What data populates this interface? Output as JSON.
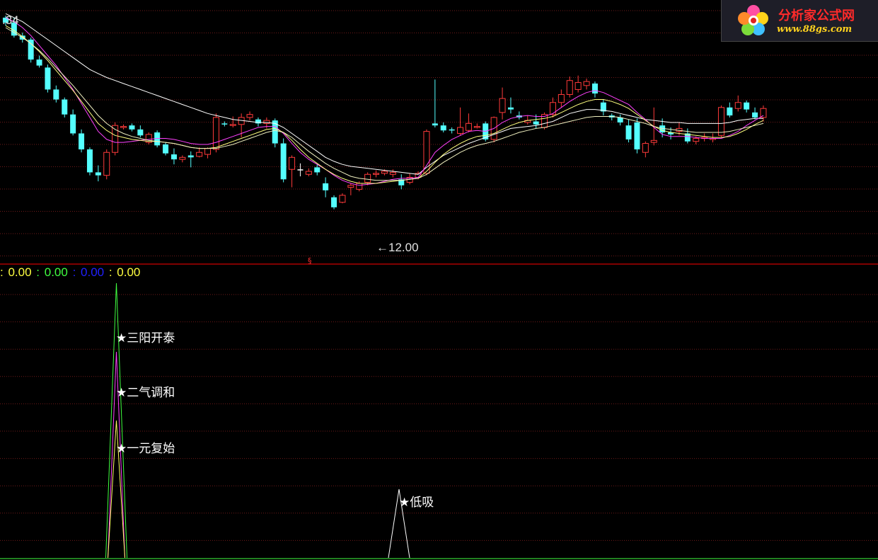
{
  "price_panel": {
    "high_label": ".34",
    "low_label": "←12.00",
    "marker": "§",
    "colors": {
      "up": "#ff3a3a",
      "down": "#54ffff",
      "doji": "#ffffff",
      "grid": "#6e1a1a",
      "divider": "#ff0000",
      "ma_white": "#ffffff",
      "ma_magenta": "#ff40ff",
      "ma_yellow": "#ffff80",
      "ma_ivory": "#f0f0c0"
    }
  },
  "indicator_panel": {
    "readout": [
      {
        "sep": ": ",
        "value": "0.00",
        "color": "#ffff40"
      },
      {
        "sep": ": ",
        "value": "0.00",
        "color": "#40ff40"
      },
      {
        "sep": ": ",
        "value": "0.00",
        "color": "#2020ff"
      },
      {
        "sep": ": ",
        "value": "0.00",
        "color": "#ffff40"
      }
    ],
    "signals": [
      {
        "label": "★三阳开泰",
        "series": "green"
      },
      {
        "label": "★二气调和",
        "series": "magenta"
      },
      {
        "label": "★一元复始",
        "series": "yellow"
      },
      {
        "label": "★低吸",
        "series": "white"
      }
    ]
  },
  "logo": {
    "brand": "分析家公式网",
    "url": "www.88gs.com",
    "icon": "flower-logo-icon"
  },
  "chart_data": {
    "type": "candlestick",
    "title": "",
    "y_range_approx": [
      12.0,
      14.34
    ],
    "candles": [
      [
        14.3,
        14.32,
        14.22,
        14.25
      ],
      [
        14.25,
        14.3,
        14.1,
        14.12
      ],
      [
        14.12,
        14.15,
        14.05,
        14.08
      ],
      [
        14.08,
        14.1,
        13.85,
        13.88
      ],
      [
        13.88,
        13.92,
        13.8,
        13.82
      ],
      [
        13.8,
        13.83,
        13.55,
        13.58
      ],
      [
        13.58,
        13.62,
        13.45,
        13.48
      ],
      [
        13.48,
        13.5,
        13.3,
        13.33
      ],
      [
        13.33,
        13.38,
        13.12,
        13.14
      ],
      [
        13.14,
        13.18,
        12.95,
        12.98
      ],
      [
        12.98,
        13.0,
        12.72,
        12.75
      ],
      [
        12.75,
        12.82,
        12.66,
        12.72
      ],
      [
        12.72,
        12.98,
        12.68,
        12.95
      ],
      [
        12.95,
        13.25,
        12.92,
        13.22
      ],
      [
        13.2,
        13.23,
        13.18,
        13.21
      ],
      [
        13.22,
        13.24,
        13.16,
        13.18
      ],
      [
        13.18,
        13.22,
        13.1,
        13.12
      ],
      [
        13.05,
        13.15,
        13.03,
        13.13
      ],
      [
        13.15,
        13.17,
        13.0,
        13.02
      ],
      [
        13.03,
        13.05,
        12.92,
        12.94
      ],
      [
        12.93,
        12.99,
        12.83,
        12.88
      ],
      [
        12.88,
        12.92,
        12.85,
        12.9
      ],
      [
        12.92,
        12.96,
        12.8,
        12.9
      ],
      [
        12.91,
        13.0,
        12.9,
        12.95
      ],
      [
        12.93,
        13.0,
        12.89,
        12.99
      ],
      [
        12.98,
        13.34,
        12.95,
        13.3
      ],
      [
        13.24,
        13.26,
        13.21,
        13.23
      ],
      [
        13.22,
        13.31,
        13.2,
        13.23
      ],
      [
        13.23,
        13.34,
        13.1,
        13.3
      ],
      [
        13.3,
        13.36,
        13.27,
        13.33
      ],
      [
        13.28,
        13.3,
        13.21,
        13.24
      ],
      [
        13.24,
        13.3,
        13.19,
        13.27
      ],
      [
        13.27,
        13.29,
        13.0,
        13.04
      ],
      [
        13.04,
        13.09,
        12.65,
        12.68
      ],
      [
        12.78,
        12.92,
        12.6,
        12.9
      ],
      [
        12.78,
        12.84,
        12.71,
        12.78
      ],
      [
        12.73,
        12.79,
        12.71,
        12.76
      ],
      [
        12.8,
        12.83,
        12.72,
        12.75
      ],
      [
        12.64,
        12.7,
        12.5,
        12.57
      ],
      [
        12.5,
        12.52,
        12.38,
        12.4
      ],
      [
        12.45,
        12.54,
        12.44,
        12.52
      ],
      [
        12.6,
        12.64,
        12.52,
        12.62
      ],
      [
        12.58,
        12.66,
        12.56,
        12.64
      ],
      [
        12.65,
        12.75,
        12.62,
        12.73
      ],
      [
        12.73,
        12.77,
        12.7,
        12.74
      ],
      [
        12.74,
        12.78,
        12.72,
        12.76
      ],
      [
        12.73,
        12.78,
        12.7,
        12.75
      ],
      [
        12.68,
        12.73,
        12.58,
        12.62
      ],
      [
        12.65,
        12.74,
        12.63,
        12.7
      ],
      [
        12.7,
        12.76,
        12.68,
        12.74
      ],
      [
        12.74,
        13.18,
        12.72,
        13.16
      ],
      [
        13.24,
        13.68,
        13.2,
        13.22
      ],
      [
        13.22,
        13.25,
        13.15,
        13.17
      ],
      [
        13.18,
        13.2,
        13.14,
        13.17
      ],
      [
        13.14,
        13.4,
        13.12,
        13.2
      ],
      [
        13.17,
        13.34,
        13.15,
        13.24
      ],
      [
        13.2,
        13.24,
        13.19,
        13.21
      ],
      [
        13.24,
        13.26,
        13.06,
        13.08
      ],
      [
        13.08,
        13.31,
        13.05,
        13.3
      ],
      [
        13.35,
        13.6,
        13.28,
        13.49
      ],
      [
        13.4,
        13.5,
        13.34,
        13.38
      ],
      [
        13.32,
        13.36,
        13.28,
        13.3
      ],
      [
        13.25,
        13.32,
        13.23,
        13.27
      ],
      [
        13.26,
        13.33,
        13.19,
        13.23
      ],
      [
        13.2,
        13.35,
        13.18,
        13.33
      ],
      [
        13.33,
        13.5,
        13.3,
        13.45
      ],
      [
        13.45,
        13.58,
        13.4,
        13.53
      ],
      [
        13.53,
        13.71,
        13.5,
        13.67
      ],
      [
        13.58,
        13.72,
        13.55,
        13.65
      ],
      [
        13.62,
        13.69,
        13.58,
        13.66
      ],
      [
        13.64,
        13.66,
        13.5,
        13.54
      ],
      [
        13.45,
        13.48,
        13.32,
        13.36
      ],
      [
        13.32,
        13.34,
        13.27,
        13.3
      ],
      [
        13.3,
        13.33,
        13.22,
        13.25
      ],
      [
        13.22,
        13.28,
        13.05,
        13.08
      ],
      [
        13.25,
        13.29,
        12.94,
        12.98
      ],
      [
        12.95,
        13.06,
        12.9,
        13.04
      ],
      [
        13.05,
        13.4,
        13.02,
        13.07
      ],
      [
        13.22,
        13.29,
        13.1,
        13.15
      ],
      [
        13.15,
        13.2,
        13.08,
        13.13
      ],
      [
        13.16,
        13.25,
        13.12,
        13.19
      ],
      [
        13.14,
        13.19,
        13.04,
        13.06
      ],
      [
        13.06,
        13.11,
        13.03,
        13.09
      ],
      [
        13.09,
        13.14,
        13.06,
        13.1
      ],
      [
        13.08,
        13.14,
        13.05,
        13.09
      ],
      [
        13.12,
        13.42,
        13.1,
        13.4
      ],
      [
        13.4,
        13.45,
        13.3,
        13.32
      ],
      [
        13.39,
        13.52,
        13.36,
        13.45
      ],
      [
        13.45,
        13.47,
        13.35,
        13.38
      ],
      [
        13.35,
        13.4,
        13.28,
        13.3
      ],
      [
        13.3,
        13.42,
        13.26,
        13.39
      ]
    ],
    "moving_averages": {
      "white": [
        14.34,
        14.3,
        14.26,
        14.2,
        14.14,
        14.08,
        14.02,
        13.96,
        13.9,
        13.84,
        13.78,
        13.74,
        13.7,
        13.67,
        13.64,
        13.61,
        13.58,
        13.55,
        13.52,
        13.49,
        13.46,
        13.43,
        13.4,
        13.37,
        13.34,
        13.32,
        13.3,
        13.28,
        13.27,
        13.26,
        13.25,
        13.25,
        13.24,
        13.2,
        13.14,
        13.08,
        13.02,
        12.96,
        12.9,
        12.86,
        12.83,
        12.81,
        12.8,
        12.79,
        12.78,
        12.77,
        12.76,
        12.75,
        12.74,
        12.73,
        12.8,
        12.86,
        12.92,
        12.96,
        13.0,
        13.04,
        13.07,
        13.1,
        13.13,
        13.16,
        13.19,
        13.2,
        13.21,
        13.22,
        13.24,
        13.26,
        13.3,
        13.34,
        13.36,
        13.38,
        13.38,
        13.37,
        13.36,
        13.34,
        13.32,
        13.3,
        13.28,
        13.27,
        13.26,
        13.25,
        13.25,
        13.24,
        13.24,
        13.24,
        13.24,
        13.24,
        13.25,
        13.27,
        13.28,
        13.29,
        13.29
      ],
      "magenta": [
        14.3,
        14.26,
        14.2,
        14.12,
        14.02,
        13.92,
        13.82,
        13.7,
        13.58,
        13.44,
        13.3,
        13.16,
        13.08,
        13.05,
        13.05,
        13.06,
        13.07,
        13.08,
        13.09,
        13.09,
        13.08,
        13.06,
        13.04,
        13.03,
        13.03,
        13.05,
        13.08,
        13.11,
        13.14,
        13.17,
        13.2,
        13.21,
        13.21,
        13.14,
        13.04,
        12.95,
        12.88,
        12.83,
        12.78,
        12.72,
        12.67,
        12.64,
        12.62,
        12.63,
        12.64,
        12.66,
        12.68,
        12.69,
        12.69,
        12.7,
        12.82,
        12.95,
        13.02,
        13.08,
        13.12,
        13.16,
        13.17,
        13.16,
        13.19,
        13.25,
        13.29,
        13.31,
        13.32,
        13.31,
        13.31,
        13.34,
        13.4,
        13.46,
        13.51,
        13.55,
        13.57,
        13.55,
        13.51,
        13.47,
        13.43,
        13.35,
        13.28,
        13.2,
        13.13,
        13.11,
        13.11,
        13.11,
        13.1,
        13.09,
        13.09,
        13.09,
        13.12,
        13.16,
        13.22,
        13.27,
        13.32
      ],
      "yellow": [
        14.22,
        14.17,
        14.11,
        14.04,
        13.96,
        13.87,
        13.77,
        13.67,
        13.57,
        13.46,
        13.35,
        13.24,
        13.17,
        13.12,
        13.1,
        13.08,
        13.07,
        13.06,
        13.06,
        13.05,
        13.04,
        13.02,
        13.0,
        12.99,
        12.99,
        13.0,
        13.03,
        13.06,
        13.09,
        13.12,
        13.15,
        13.18,
        13.19,
        13.15,
        13.07,
        12.98,
        12.9,
        12.84,
        12.78,
        12.73,
        12.69,
        12.66,
        12.64,
        12.64,
        12.64,
        12.65,
        12.66,
        12.67,
        12.68,
        12.69,
        12.76,
        12.85,
        12.93,
        12.99,
        13.04,
        13.08,
        13.11,
        13.12,
        13.14,
        13.18,
        13.22,
        13.25,
        13.27,
        13.28,
        13.29,
        13.31,
        13.35,
        13.39,
        13.43,
        13.46,
        13.48,
        13.48,
        13.46,
        13.43,
        13.39,
        13.33,
        13.27,
        13.21,
        13.17,
        13.15,
        13.14,
        13.13,
        13.12,
        13.11,
        13.1,
        13.1,
        13.11,
        13.14,
        13.18,
        13.23,
        13.27
      ],
      "ivory": [
        14.2,
        14.15,
        14.1,
        14.04,
        13.97,
        13.89,
        13.8,
        13.71,
        13.62,
        13.52,
        13.42,
        13.32,
        13.24,
        13.18,
        13.14,
        13.11,
        13.09,
        13.07,
        13.06,
        13.05,
        13.04,
        13.02,
        13.0,
        12.99,
        12.99,
        12.99,
        13.01,
        13.03,
        13.06,
        13.09,
        13.12,
        13.15,
        13.17,
        13.15,
        13.1,
        13.03,
        12.96,
        12.9,
        12.84,
        12.79,
        12.75,
        12.71,
        12.69,
        12.68,
        12.67,
        12.67,
        12.67,
        12.67,
        12.68,
        12.69,
        12.73,
        12.79,
        12.85,
        12.9,
        12.95,
        12.99,
        13.02,
        13.04,
        13.06,
        13.09,
        13.12,
        13.15,
        13.17,
        13.19,
        13.2,
        13.22,
        13.24,
        13.26,
        13.28,
        13.3,
        13.31,
        13.31,
        13.31,
        13.3,
        13.28,
        13.26,
        13.24,
        13.21,
        13.19,
        13.18,
        13.17,
        13.16,
        13.15,
        13.15,
        13.15,
        13.15,
        13.16,
        13.18,
        13.2,
        13.22,
        13.24
      ]
    },
    "indicator_signals": [
      {
        "series": "green",
        "value": 1.0
      },
      {
        "series": "magenta",
        "value": 0.75
      },
      {
        "series": "yellow",
        "value": 0.5
      },
      {
        "series": "white",
        "value": 0.25
      }
    ]
  }
}
